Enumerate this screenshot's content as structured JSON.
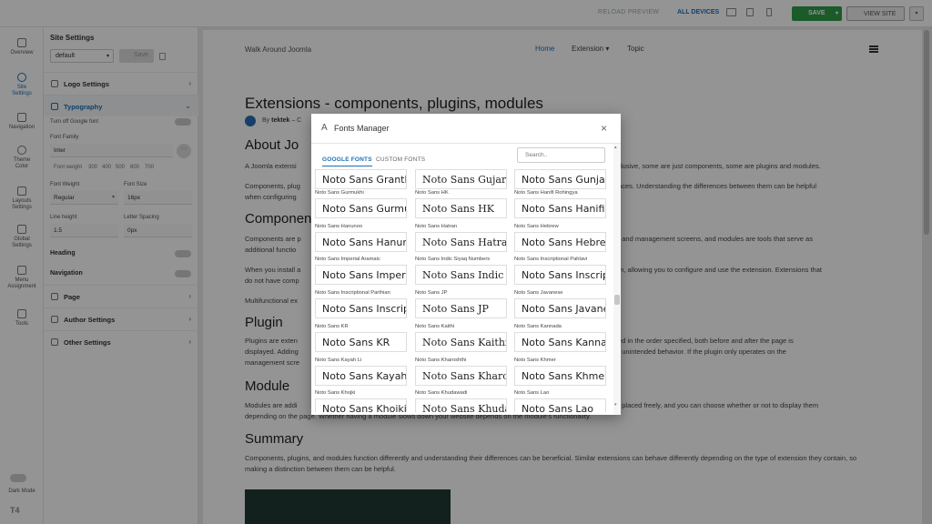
{
  "topbar": {
    "reload_label": "RELOAD PREVIEW",
    "devices_label": "ALL DEVICES",
    "save_label": "SAVE",
    "view_site_label": "VIEW SITE"
  },
  "rail": {
    "items": [
      {
        "label": "Overview",
        "icon": "overview-icon"
      },
      {
        "label": "Site Settings",
        "icon": "gear-icon"
      },
      {
        "label": "Navigation",
        "icon": "menu-icon"
      },
      {
        "label": "Theme Color",
        "icon": "palette-icon"
      },
      {
        "label": "Layouts Settings",
        "icon": "layout-icon"
      },
      {
        "label": "Global Settings",
        "icon": "gears-icon"
      },
      {
        "label": "Menu Assignment",
        "icon": "menu-assignment-icon"
      },
      {
        "label": "Tools",
        "icon": "tools-icon"
      }
    ],
    "dark_mode_label": "Dark Mode",
    "brand": "T4"
  },
  "panel": {
    "title": "Site Settings",
    "preset_value": "default",
    "save_label": "Save",
    "logo_settings": "Logo Settings",
    "typography": "Typography",
    "google_font_label": "Turn off Google font",
    "font_family_label": "Font Family",
    "font_family_value": "Inter",
    "font_weight_inline_label": "Font weight",
    "weights": [
      "300",
      "400",
      "500",
      "600",
      "700"
    ],
    "font_weight_label": "Font Weight",
    "font_weight_value": "Regular",
    "font_size_label": "Font Size",
    "font_size_value": "16px",
    "line_height_label": "Line height",
    "line_height_value": "1.5",
    "letter_spacing_label": "Letter Spacing",
    "letter_spacing_value": "0px",
    "heading_label": "Heading",
    "navigation_label": "Navigation",
    "page_label": "Page",
    "author_settings": "Author Settings",
    "other_settings": "Other Settings"
  },
  "preview": {
    "logo_alt": "Walk Around Joomla",
    "nav": [
      "Home",
      "Extension ▾",
      "Topic"
    ],
    "h1": "Extensions - components, plugins, modules",
    "meta_by": "By",
    "meta_author": "tektek",
    "meta_rest": "– C",
    "h2_about": "About Jo",
    "p_about_left": "A Joomla extensi",
    "p_about_right": "lusive, some are just components, some are plugins and modules.",
    "p_comp_left": "Components, plug",
    "p_comp_left2": "when configuring",
    "p_comp_right": "faces. Understanding the differences between them can be helpful",
    "h2_components": "Componen",
    "p_compo_left": "Components are p",
    "p_compo_left2": "additional functio",
    "p_compo_right": "e and management screens, and modules are tools that serve as",
    "p_install_left": "When you install a",
    "p_install_left2": "do not have comp",
    "p_install_right": "en, allowing you to configure and use the extension. Extensions that",
    "p_multi": "Multifunctional ex",
    "h2_plugin": "Plugin",
    "p_plugin_left": "Plugins are exten",
    "p_plugin_left2": "displayed. Adding",
    "p_plugin_left3": "management scre",
    "p_plugin_right": "ted in the order specified, both before and after the page is",
    "p_plugin_right2": "e unintended behavior. If the plugin only operates on the",
    "h2_module": "Module",
    "p_module_left": "Modules are addi",
    "p_module_right": "e placed freely, and you can choose whether or not to display them",
    "p_module_2": "depending on the page. Whether having a module slows down your website depends on the module's functionality.",
    "h2_summary": "Summary",
    "p_summary": "Components, plugins, and modules function differently and understanding their differences can be beneficial. Similar extensions can behave differently depending on the type of extension they contain, so making a distinction between them can be helpful."
  },
  "modal": {
    "title": "Fonts Manager",
    "tabs": [
      "GOOGLE FONTS",
      "CUSTOM FONTS"
    ],
    "search_placeholder": "Search..",
    "fonts": [
      [
        "",
        "Noto Sans Grantha"
      ],
      [
        "",
        "Noto Sans Gujarati"
      ],
      [
        "",
        "Noto Sans Gunjala Gondi"
      ],
      [
        "Noto Sans Gurmukhi",
        "Noto Sans Gurmukhi"
      ],
      [
        "Noto Sans HK",
        "Noto Sans HK"
      ],
      [
        "Noto Sans Hanifi Rohingya",
        "Noto Sans Hanifi Rohingya"
      ],
      [
        "Noto Sans Hanunoo",
        "Noto Sans Hanunoo"
      ],
      [
        "Noto Sans Hatran",
        "Noto Sans Hatran"
      ],
      [
        "Noto Sans Hebrew",
        "Noto Sans Hebrew"
      ],
      [
        "Noto Sans Imperial Aramaic",
        "Noto Sans Imperial Aramaic"
      ],
      [
        "Noto Sans Indic Siyaq Numbers",
        "Noto Sans Indic Siyaq Numbers"
      ],
      [
        "Noto Sans Inscriptional Pahlavi",
        "Noto Sans Inscriptional Pahlavi"
      ],
      [
        "Noto Sans Inscriptional Parthian",
        "Noto Sans Inscriptional Parthian"
      ],
      [
        "Noto Sans JP",
        "Noto Sans JP"
      ],
      [
        "Noto Sans Javanese",
        "Noto Sans Javanese"
      ],
      [
        "Noto Sans KR",
        "Noto Sans KR"
      ],
      [
        "Noto Sans Kaithi",
        "Noto Sans Kaithi"
      ],
      [
        "Noto Sans Kannada",
        "Noto Sans Kannada"
      ],
      [
        "Noto Sans Kayah Li",
        "Noto Sans Kayah Li"
      ],
      [
        "Noto Sans Kharoshthi",
        "Noto Sans Kharoshthi"
      ],
      [
        "Noto Sans Khmer",
        "Noto Sans Khmer"
      ],
      [
        "Noto Sans Khojki",
        "Noto Sans Khojki"
      ],
      [
        "Noto Sans Khudawadi",
        "Noto Sans Khudawadi"
      ],
      [
        "Noto Sans Lao",
        "Noto Sans Lao"
      ]
    ]
  }
}
